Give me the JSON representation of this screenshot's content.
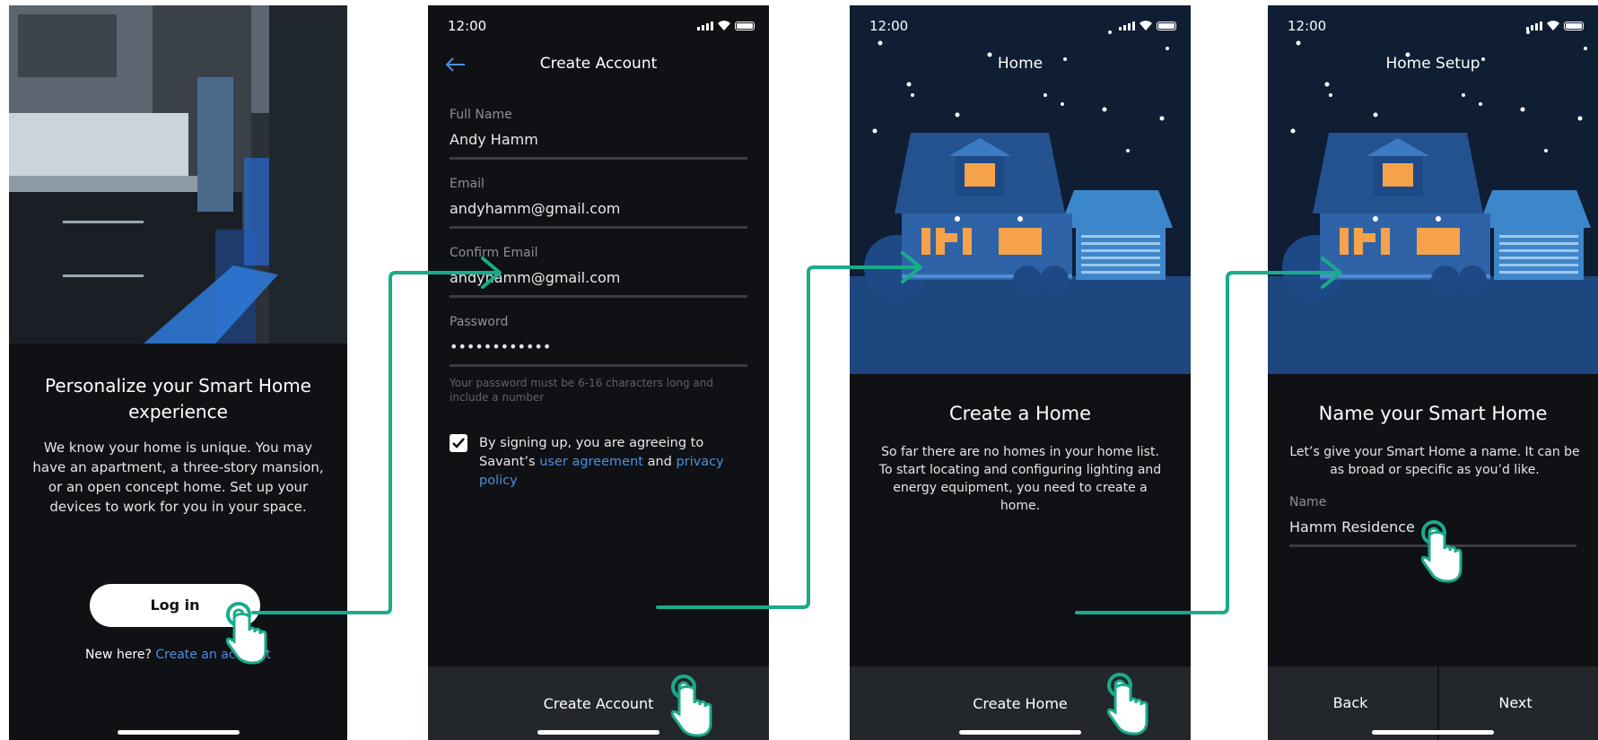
{
  "status": {
    "time": "12:00"
  },
  "screen1": {
    "title": "Personalize your Smart Home experience",
    "body": "We know your home is unique. You may have an apartment, a three-story mansion, or an open concept home. Set up your devices to work for you in your space.",
    "login_label": "Log in",
    "new_here": "New here?",
    "create_link": "Create an account"
  },
  "screen2": {
    "title": "Create Account",
    "fields": [
      {
        "label": "Full Name",
        "value": "Andy Hamm"
      },
      {
        "label": "Email",
        "value": "andyhamm@gmail.com"
      },
      {
        "label": "Confirm Email",
        "value": "andyhamm@gmail.com"
      },
      {
        "label": "Password",
        "value": "••••••••••••"
      }
    ],
    "password_hint": "Your password must be 6-16 characters long and include a number",
    "agree_prefix": "By signing up, you are agreeing to Savant’s",
    "user_agreement": "user agreement",
    "and": "and",
    "privacy_policy": "privacy policy",
    "button_label": "Create Account"
  },
  "screen3": {
    "title": "Home",
    "heading": "Create a Home",
    "body": "So far there are no homes in your home list. To start locating and configuring lighting and energy equipment, you need to create a home.",
    "button_label": "Create Home"
  },
  "screen4": {
    "title": "Home Setup",
    "heading": "Name your Smart Home",
    "body": "Let’s give your Smart Home a name. It can be as broad or specific as you’d like.",
    "field_label": "Name",
    "field_value": "Hamm Residence",
    "back_label": "Back",
    "next_label": "Next"
  },
  "colors": {
    "background": "#0f1115",
    "night_sky": "#0f1e33",
    "house_blue": "#24518f",
    "link_blue": "#4f8fe0",
    "flow_teal": "#1aab8a",
    "window_orange": "#f5a24a"
  },
  "icons": [
    "back-arrow-icon",
    "signal-icon",
    "wifi-icon",
    "battery-icon",
    "checkbox-checked-icon",
    "tap-hand-icon",
    "flow-arrow-icon"
  ]
}
